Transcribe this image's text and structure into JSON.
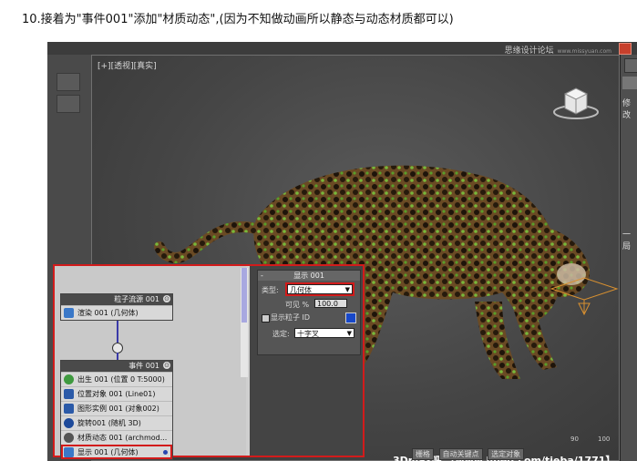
{
  "caption": "10.接着为\"事件001\"添加\"材质动态\",(因为不知做动画所以静态与动态材质都可以)",
  "watermark_top": "思缘设计论坛",
  "watermark_top_small": "www.missyuan.com",
  "viewport_label": "[+][透视][真实]",
  "right_panel": {
    "tab_label": "修改",
    "label2": "一局"
  },
  "particle_view": {
    "flow_node": {
      "title": "粒子流源 001",
      "ops": [
        {
          "label": "渲染 001 (几何体)"
        }
      ]
    },
    "event_node": {
      "title": "事件 001",
      "ops": [
        {
          "label": "出生 001 (位置 0 T:5000)"
        },
        {
          "label": "位置对象 001 (Line01)"
        },
        {
          "label": "图形实例 001 (对象002)"
        },
        {
          "label": "旋转001 (随机 3D)"
        },
        {
          "label": "材质动态 001 (archmod..."
        },
        {
          "label": "显示 001 (几何体)"
        }
      ]
    },
    "rollout": {
      "title": "显示 001",
      "type_label": "类型:",
      "type_value": "几何体",
      "visible_label": "可见 %",
      "visible_value": "100.0",
      "show_id_label": "显示粒子 ID",
      "selected_label": "选定:",
      "selected_value": "十字叉"
    }
  },
  "bottom_watermark": "3Dmax吧 【www.lineg.com/tieba/1771】",
  "bottom_buttons": [
    "栅格",
    "自动关键点",
    "选定对象"
  ],
  "timeline_ticks": [
    "90",
    "100"
  ],
  "colors": {
    "highlight": "#d21b1b",
    "selection_blue": "#1848c8"
  }
}
